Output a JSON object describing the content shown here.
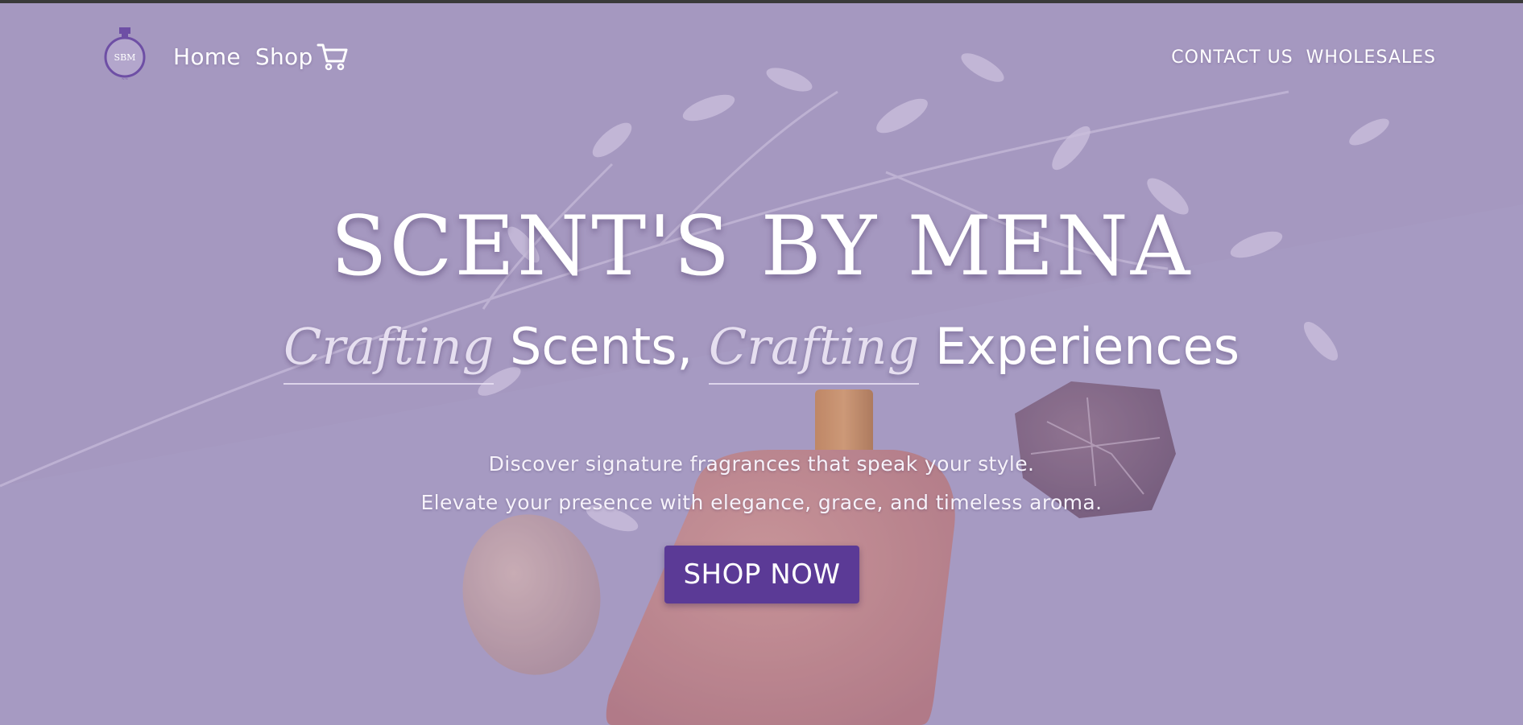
{
  "nav": {
    "home_label": "Home",
    "shop_label": "Shop",
    "contact_label": "CONTACT US",
    "wholesale_label": "WHOLESALES",
    "logo_text": "SBM"
  },
  "hero": {
    "title": "SCENT'S BY MENA",
    "tagline_em_1": "Crafting",
    "tagline_word_1": " Scents, ",
    "tagline_em_2": "Crafting",
    "tagline_word_2": " Experiences",
    "description_line_1": "Discover signature fragrances that speak your style.",
    "description_line_2": "Elevate your presence with elegance, grace, and timeless aroma.",
    "cta_label": "SHOP NOW"
  },
  "colors": {
    "accent": "#5b3a96",
    "overlay": "#a79cbf",
    "text": "#ffffff"
  },
  "icons": {
    "cart": "cart-icon",
    "logo": "perfume-bottle-logo"
  }
}
